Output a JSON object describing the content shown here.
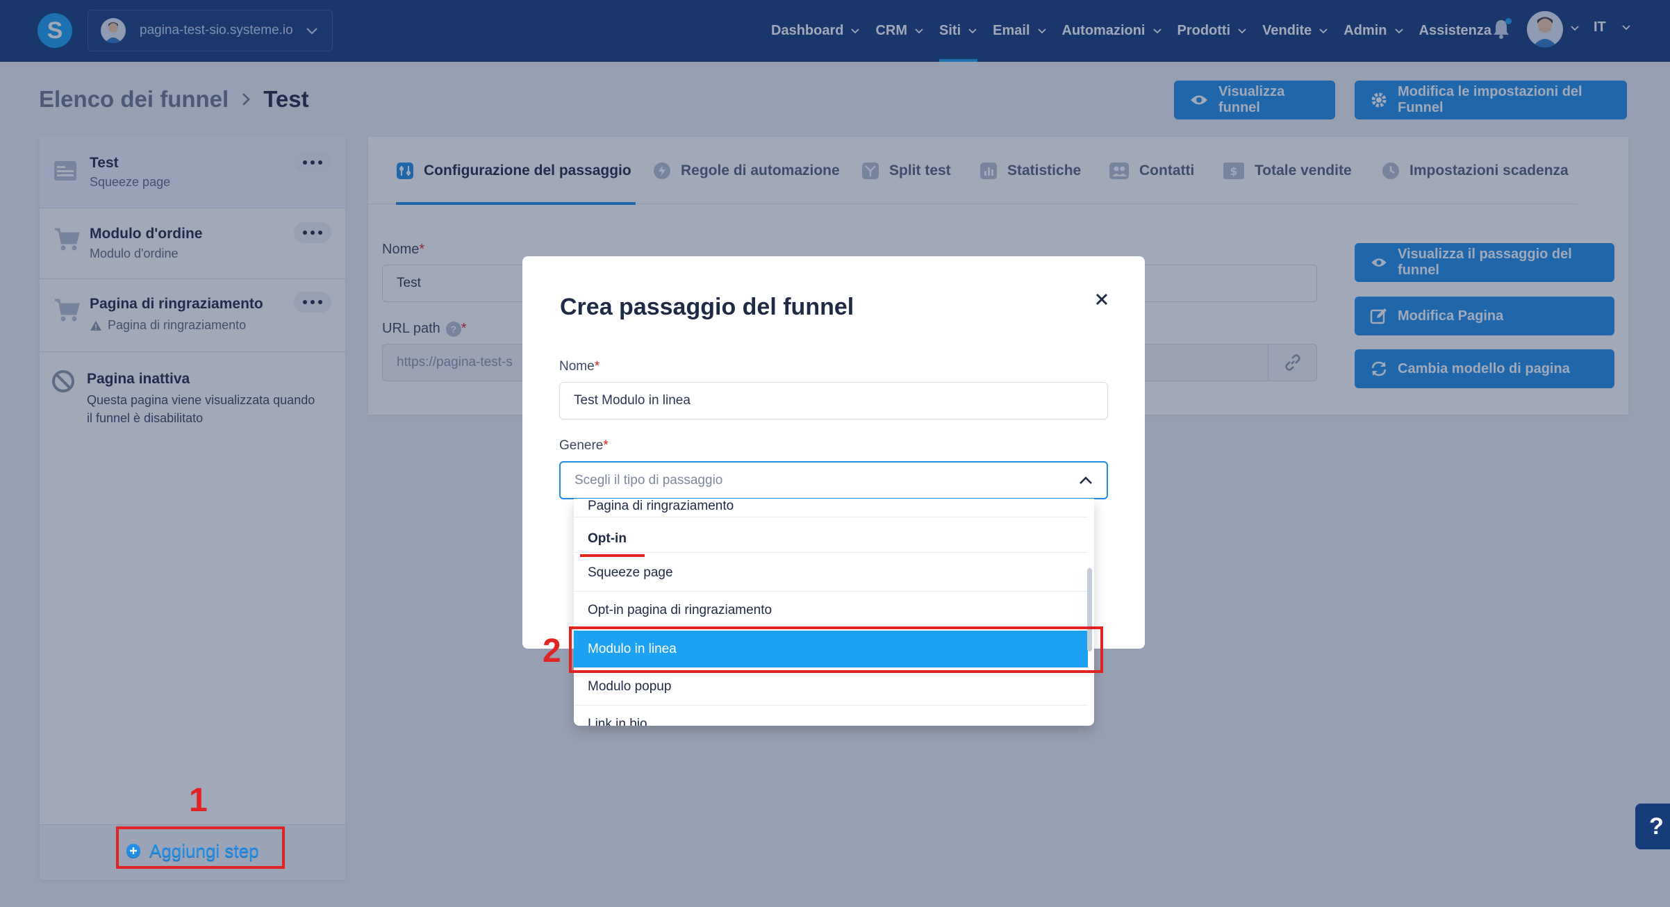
{
  "topbar": {
    "logo_letter": "S",
    "site_name": "pagina-test-sio.systeme.io",
    "nav": [
      {
        "label": "Dashboard"
      },
      {
        "label": "CRM"
      },
      {
        "label": "Siti",
        "active": true
      },
      {
        "label": "Email"
      },
      {
        "label": "Automazioni"
      },
      {
        "label": "Prodotti"
      },
      {
        "label": "Vendite"
      },
      {
        "label": "Admin"
      },
      {
        "label": "Assistenza"
      }
    ],
    "language": "IT",
    "notification_icon": "bell-icon"
  },
  "breadcrumb": {
    "parent": "Elenco dei funnel",
    "separator": ">",
    "current": "Test"
  },
  "header_actions": {
    "view_funnel": "Visualizza funnel",
    "funnel_settings": "Modifica le impostazioni del Funnel"
  },
  "sidebar": {
    "steps": [
      {
        "title": "Test",
        "subtitle": "Squeeze page",
        "icon": "page-icon"
      },
      {
        "title": "Modulo d'ordine",
        "subtitle": "Modulo d'ordine",
        "icon": "cart-icon"
      },
      {
        "title": "Pagina di ringraziamento",
        "subtitle": "Pagina di ringraziamento",
        "icon": "cart-icon"
      }
    ],
    "inactive": {
      "title": "Pagina inattiva",
      "description": "Questa pagina viene visualizzata quando il funnel è disabilitato"
    },
    "add_step": "Aggiungi step"
  },
  "tabs": [
    {
      "label": "Configurazione del passaggio",
      "icon": "settings-icon",
      "active": true
    },
    {
      "label": "Regole di automazione",
      "icon": "bolt-icon"
    },
    {
      "label": "Split test",
      "icon": "split-icon"
    },
    {
      "label": "Statistiche",
      "icon": "chart-icon"
    },
    {
      "label": "Contatti",
      "icon": "users-icon"
    },
    {
      "label": "Totale vendite",
      "icon": "dollar-icon"
    },
    {
      "label": "Impostazioni scadenza",
      "icon": "clock-icon"
    }
  ],
  "form": {
    "name_label": "Nome",
    "name_value": "Test",
    "url_label": "URL path",
    "url_value": "https://pagina-test-s"
  },
  "side_actions": {
    "view_step": "Visualizza il passaggio del funnel",
    "edit_page": "Modifica Pagina",
    "change_template": "Cambia modello di pagina"
  },
  "modal": {
    "title": "Crea passaggio del funnel",
    "close": "×",
    "name_label": "Nome",
    "name_value": "Test Modulo in linea",
    "type_label": "Genere",
    "type_placeholder": "Scegli il tipo di passaggio",
    "required_mark": "*"
  },
  "dropdown": {
    "partial_top": "Pagina di ringraziamento",
    "group": "Opt-in",
    "options": [
      "Squeeze page",
      "Opt-in pagina di ringraziamento",
      "Modulo in linea",
      "Modulo popup"
    ],
    "selected": "Modulo in linea",
    "partial_bottom": "Link in bio"
  },
  "annotations": {
    "step1": "1",
    "step2": "2"
  },
  "help_button": "?",
  "colors": {
    "topbar": "#163d7a",
    "primary": "#1f8ee8",
    "highlight": "#e02424",
    "selected_option": "#1da1f2"
  }
}
